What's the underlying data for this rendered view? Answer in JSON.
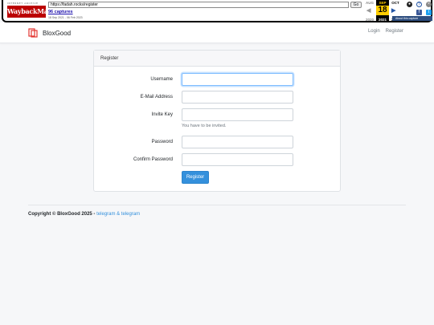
{
  "wayback": {
    "url": "https://fadah.rocks/register",
    "go_label": "Go",
    "captures": "96 captures",
    "range": "18 Sep 2021 - 06 Feb 2023",
    "months": {
      "prev": "AUG",
      "current": "SEP",
      "next": "OCT"
    },
    "day": "18",
    "years": {
      "prev": "2020",
      "current": "2021",
      "next": "2022"
    },
    "about": "About this capture",
    "logo_text": "WaybackMachine",
    "ia_text": "INTERNET ARCHIVE"
  },
  "navbar": {
    "brand": "BloxGood",
    "login": "Login",
    "register": "Register",
    "brand_color": "#e3342f"
  },
  "form": {
    "header": "Register",
    "fields": {
      "username": {
        "label": "Username",
        "value": ""
      },
      "email": {
        "label": "E-Mail Address",
        "value": ""
      },
      "invite": {
        "label": "Invite Key",
        "value": "",
        "help": "You have to be invited."
      },
      "password": {
        "label": "Password",
        "value": ""
      },
      "confirm": {
        "label": "Confirm Password",
        "value": ""
      }
    },
    "submit": "Register",
    "accent": "#3490dc"
  },
  "footer": {
    "copyright": "Copyright © BloxGood 2025 - ",
    "link": "telegram & telegram"
  }
}
